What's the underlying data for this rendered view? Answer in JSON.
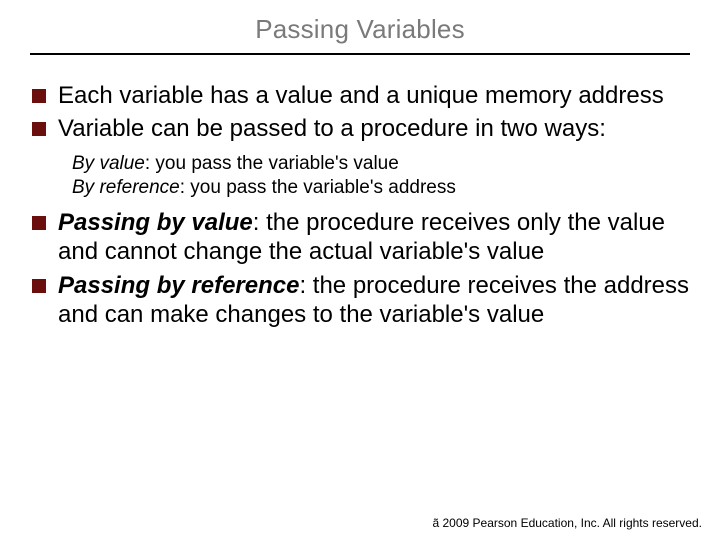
{
  "slide": {
    "title": "Passing Variables",
    "bullets": [
      {
        "text": "Each variable has a value and a unique memory address"
      },
      {
        "text": "Variable can be passed to a procedure in two ways:"
      }
    ],
    "sub_bullets": [
      {
        "term": "By value",
        "rest": ": you pass the variable's value"
      },
      {
        "term": "By reference",
        "rest": ": you pass the variable's address"
      }
    ],
    "bullets2": [
      {
        "term": "Passing by value",
        "rest": ": the procedure receives only the value and cannot change the actual variable's value"
      },
      {
        "term": "Passing by reference",
        "rest": ": the procedure receives the address and can make changes to the variable's value"
      }
    ],
    "footer": {
      "copyright_symbol": "ã",
      "text": " 2009 Pearson Education, Inc.  All rights reserved."
    }
  }
}
